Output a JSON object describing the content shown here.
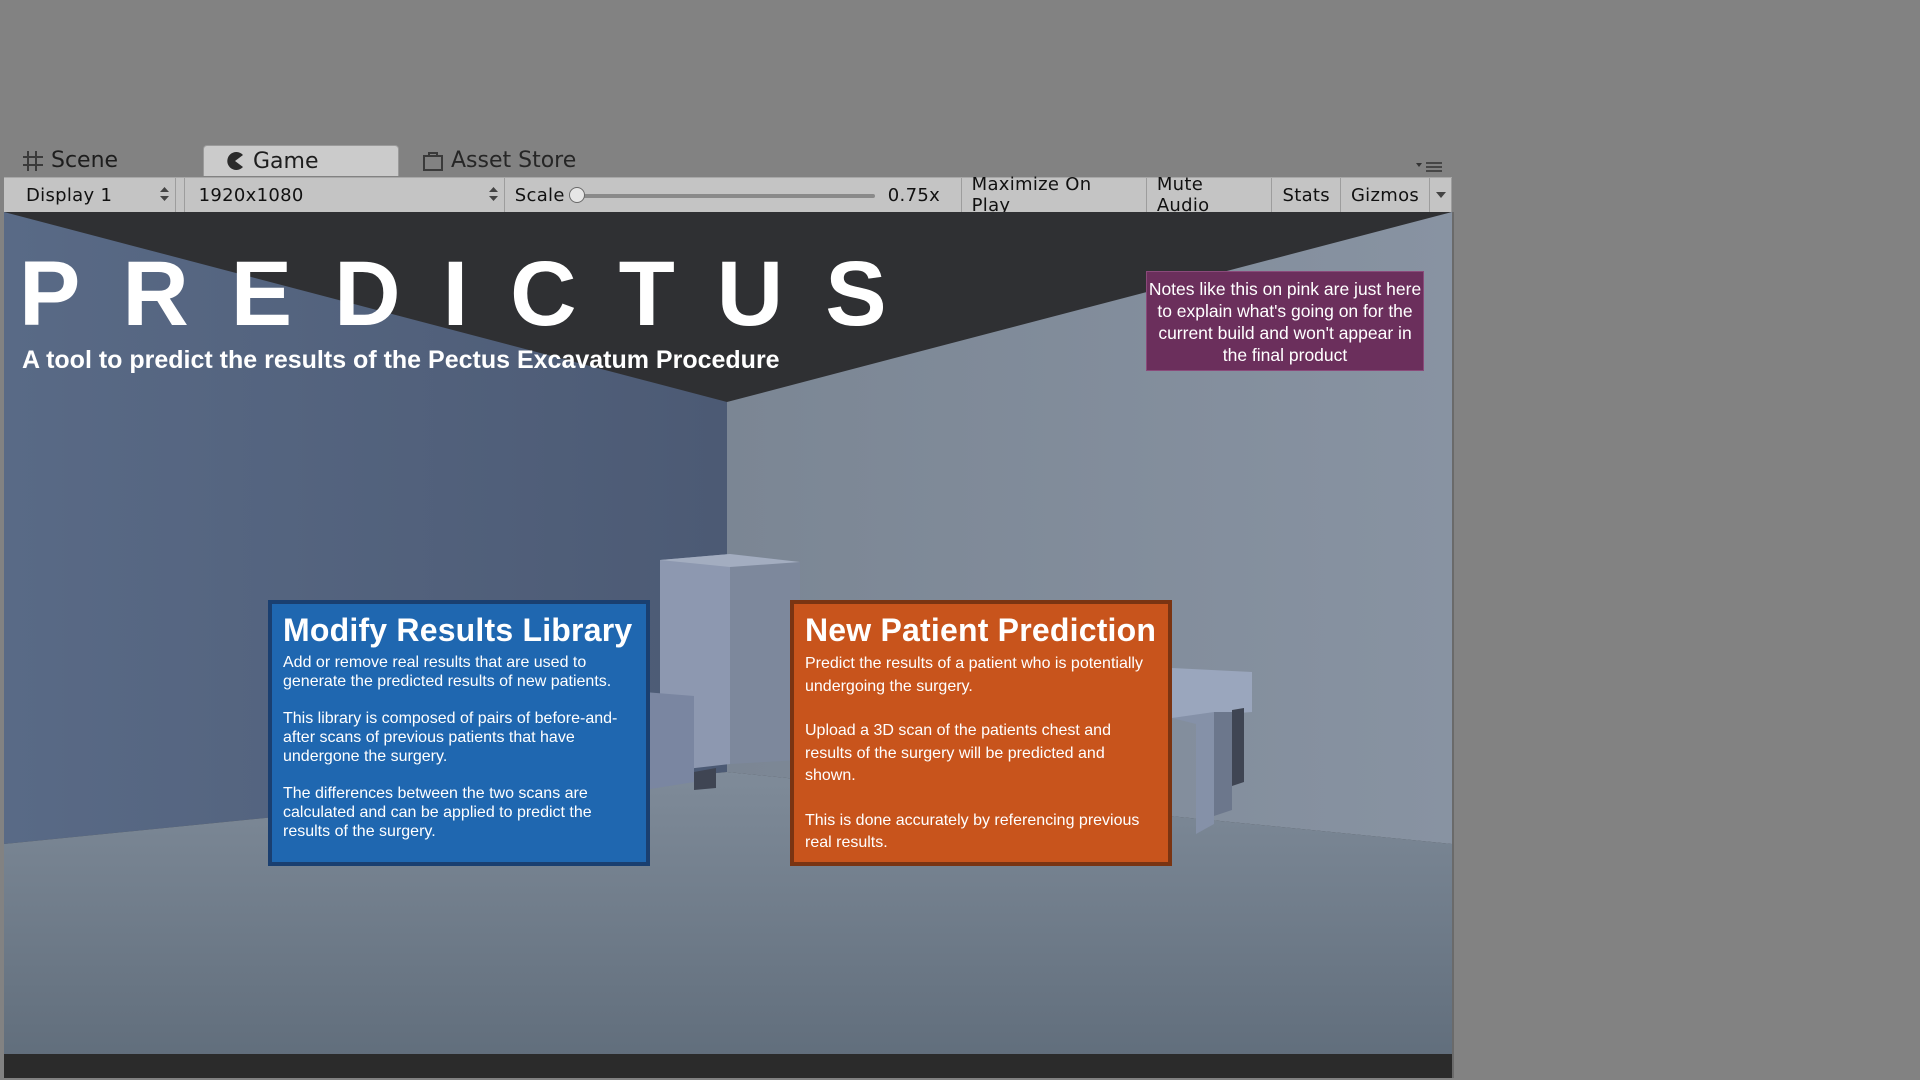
{
  "tabs": [
    {
      "label": "Scene",
      "icon": "grid-icon"
    },
    {
      "label": "Game",
      "icon": "pacman-icon",
      "active": true
    },
    {
      "label": "Asset Store",
      "icon": "store-bag-icon"
    }
  ],
  "toolbar": {
    "display": "Display 1",
    "resolution": "1920x1080",
    "scale_label": "Scale",
    "scale_value": "0.75x",
    "scale_fraction": 0.0,
    "maximize": "Maximize On Play",
    "mute": "Mute Audio",
    "stats": "Stats",
    "gizmos": "Gizmos"
  },
  "game": {
    "logo": "PREDICTUS",
    "subtitle": "A tool to predict the results of the Pectus Excavatum Procedure",
    "note": "Notes like this on pink are just here to explain what's going on for the current build and won't appear in the final product",
    "cards": [
      {
        "title": "Modify Results Library",
        "paragraphs": [
          "Add or remove real results that are used to generate the predicted results of new patients.",
          "This library is composed of pairs of before-and-after scans of previous patients that have undergone the surgery.",
          "The differences between the two scans are calculated and can be applied to predict the results of the surgery."
        ],
        "color": "#1f67b0"
      },
      {
        "title": "New Patient Prediction",
        "paragraphs": [
          "Predict the results of a patient who is potentially undergoing the surgery.",
          "Upload a 3D scan of the patients chest and results of the surgery will be predicted and shown.",
          "This is done accurately by referencing previous real results."
        ],
        "color": "#c8541c"
      }
    ]
  }
}
